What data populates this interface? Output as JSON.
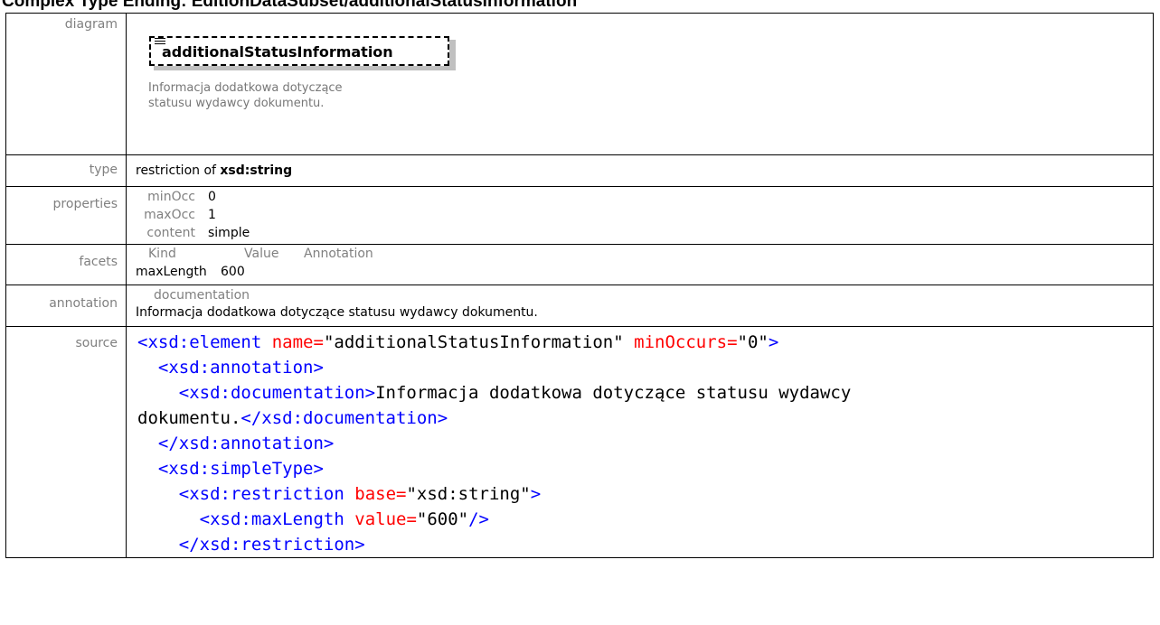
{
  "header": {
    "title": "Complex Type Ending: EditionDataSubset/additionalStatusInformation"
  },
  "rows": {
    "diagram_label": "diagram",
    "type_label": "type",
    "properties_label": "properties",
    "facets_label": "facets",
    "annotation_label": "annotation",
    "source_label": "source"
  },
  "diagram": {
    "element_name": "additionalStatusInformation",
    "doc_line1": "Informacja dodatkowa dotyczące",
    "doc_line2": "statusu wydawcy dokumentu."
  },
  "type": {
    "prefix": "restriction of",
    "base": "xsd:string"
  },
  "properties": [
    {
      "key": "minOcc",
      "value": "0"
    },
    {
      "key": "maxOcc",
      "value": "1"
    },
    {
      "key": "content",
      "value": "simple"
    }
  ],
  "facets": {
    "headers": [
      "Kind",
      "Value",
      "Annotation"
    ],
    "rows": [
      {
        "kind": "maxLength",
        "value": "600",
        "annotation": ""
      }
    ]
  },
  "annotation": {
    "heading": "documentation",
    "text": "Informacja dodatkowa dotyczące statusu wydawcy dokumentu."
  },
  "source": {
    "l1_open": "<xsd:element",
    "l1_attr1": "name=",
    "l1_val1": "\"additionalStatusInformation\"",
    "l1_attr2": "minOccurs=",
    "l1_val2": "\"0\"",
    "l1_close": ">",
    "l2": "<xsd:annotation>",
    "l3_open": "<xsd:documentation>",
    "l3_text": "Informacja dodatkowa dotyczące statusu wydawcy",
    "l4_text": "dokumentu.",
    "l4_close": "</xsd:documentation>",
    "l5": "</xsd:annotation>",
    "l6": "<xsd:simpleType>",
    "l7_open": "<xsd:restriction",
    "l7_attr": "base=",
    "l7_val": "\"xsd:string\"",
    "l7_close": ">",
    "l8_open": "<xsd:maxLength",
    "l8_attr": "value=",
    "l8_val": "\"600\"",
    "l8_close": "/>",
    "l9": "</xsd:restriction>"
  }
}
